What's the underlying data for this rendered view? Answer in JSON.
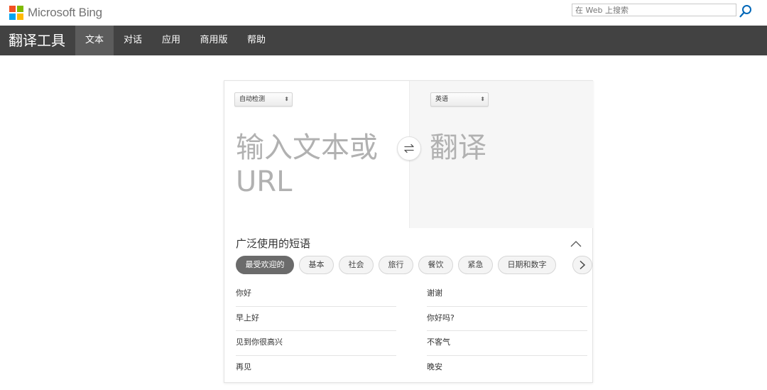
{
  "header": {
    "logo_text": "Microsoft Bing",
    "search_placeholder": "在 Web 上搜索",
    "logo_colors": [
      "#f25022",
      "#7fba00",
      "#00a4ef",
      "#ffb900"
    ]
  },
  "nav": {
    "title": "翻译工具",
    "tabs": [
      {
        "label": "文本",
        "active": true
      },
      {
        "label": "对话",
        "active": false
      },
      {
        "label": "应用",
        "active": false
      },
      {
        "label": "商用版",
        "active": false
      },
      {
        "label": "帮助",
        "active": false
      }
    ]
  },
  "translator": {
    "source_language": "自动检测",
    "target_language": "英语",
    "source_placeholder": "输入文本或 URL",
    "target_placeholder": "翻译"
  },
  "phrases": {
    "heading": "广泛使用的短语",
    "categories": [
      {
        "label": "最受欢迎的",
        "active": true
      },
      {
        "label": "基本",
        "active": false
      },
      {
        "label": "社会",
        "active": false
      },
      {
        "label": "旅行",
        "active": false
      },
      {
        "label": "餐饮",
        "active": false
      },
      {
        "label": "紧急",
        "active": false
      },
      {
        "label": "日期和数字",
        "active": false
      }
    ],
    "left": [
      "你好",
      "早上好",
      "见到你很高兴",
      "再见"
    ],
    "right": [
      "谢谢",
      "你好吗?",
      "不客气",
      "晚安"
    ]
  },
  "colors": {
    "nav_bg": "#424242",
    "nav_active": "#5c5c5c",
    "search_icon": "#0067b8"
  }
}
